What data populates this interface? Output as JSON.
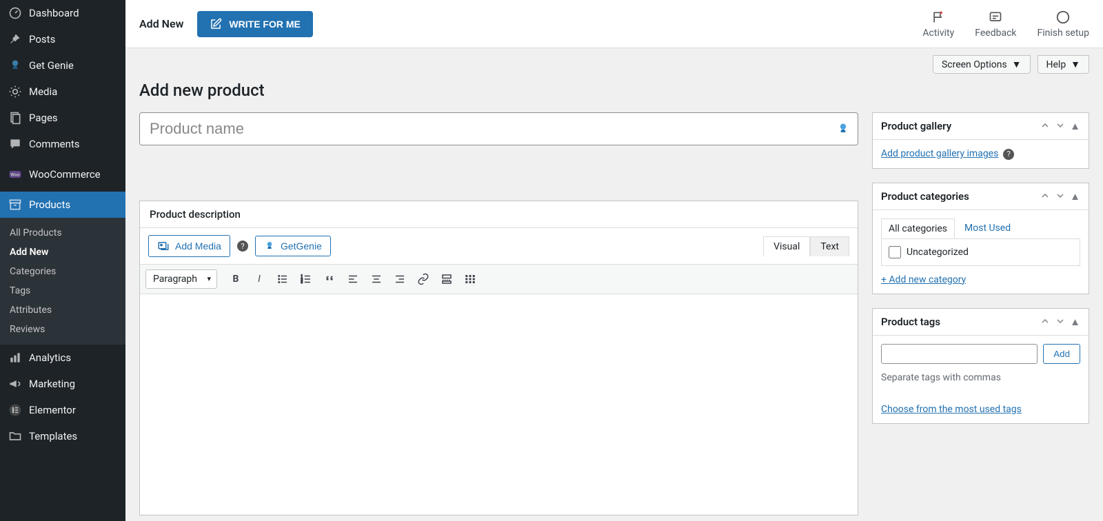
{
  "sidebar": {
    "items": [
      {
        "label": "Dashboard",
        "icon": "gauge-icon"
      },
      {
        "label": "Posts",
        "icon": "pin-icon"
      },
      {
        "label": "Get Genie",
        "icon": "genie-icon"
      },
      {
        "label": "Media",
        "icon": "media-icon"
      },
      {
        "label": "Pages",
        "icon": "page-icon"
      },
      {
        "label": "Comments",
        "icon": "comment-icon"
      },
      {
        "label": "WooCommerce",
        "icon": "woo-icon"
      },
      {
        "label": "Products",
        "icon": "archive-icon",
        "active": true
      },
      {
        "label": "Analytics",
        "icon": "bars-icon"
      },
      {
        "label": "Marketing",
        "icon": "megaphone-icon"
      },
      {
        "label": "Elementor",
        "icon": "elementor-icon"
      },
      {
        "label": "Templates",
        "icon": "folder-icon"
      }
    ],
    "sub": [
      "All Products",
      "Add New",
      "Categories",
      "Tags",
      "Attributes",
      "Reviews"
    ],
    "sub_current": "Add New"
  },
  "topbar": {
    "crumb": "Add New",
    "write_label": "WRITE FOR ME",
    "right": [
      {
        "label": "Activity",
        "icon": "flag-icon"
      },
      {
        "label": "Feedback",
        "icon": "chat-icon"
      },
      {
        "label": "Finish setup",
        "icon": "circle-icon"
      }
    ]
  },
  "screen_options": {
    "screen": "Screen Options",
    "help": "Help"
  },
  "page_title": "Add new product",
  "title_input": {
    "placeholder": "Product name"
  },
  "description": {
    "heading": "Product description",
    "add_media": "Add Media",
    "getgenie": "GetGenie",
    "tabs": {
      "visual": "Visual",
      "text": "Text"
    },
    "paragraph": "Paragraph"
  },
  "gallery": {
    "heading": "Product gallery",
    "link": "Add product gallery images"
  },
  "categories": {
    "heading": "Product categories",
    "tabs": {
      "all": "All categories",
      "most": "Most Used"
    },
    "items": [
      "Uncategorized"
    ],
    "add_link": "+ Add new category"
  },
  "tags": {
    "heading": "Product tags",
    "add_btn": "Add",
    "hint": "Separate tags with commas",
    "choose": "Choose from the most used tags"
  }
}
